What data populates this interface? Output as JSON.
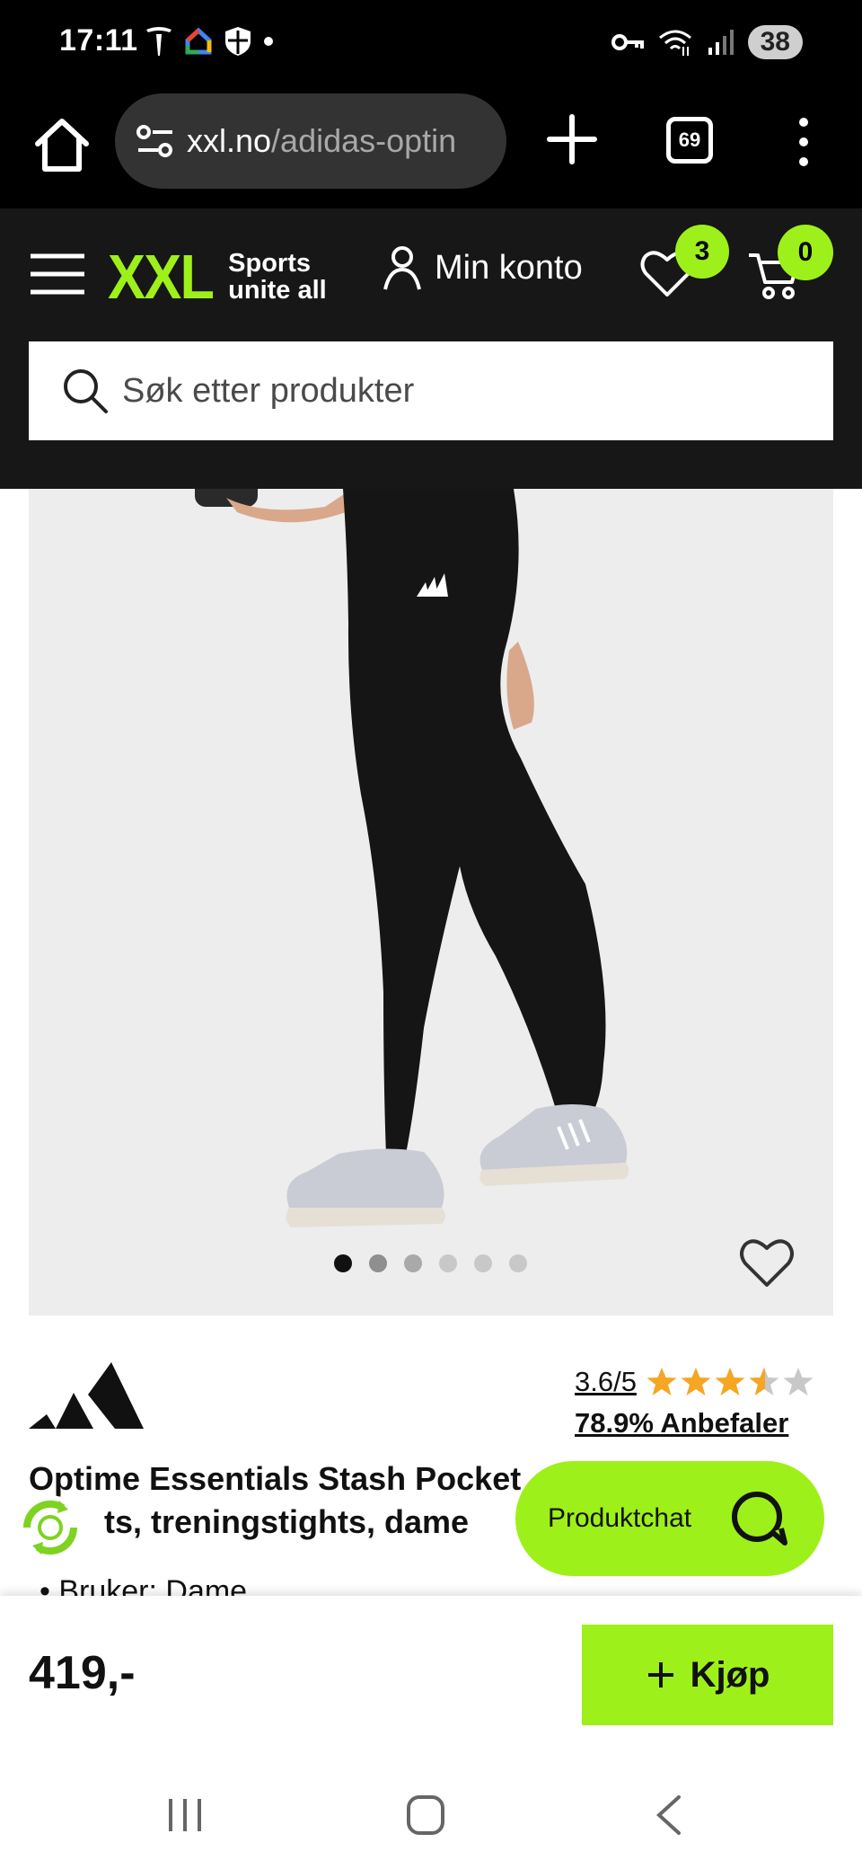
{
  "status_bar": {
    "time": "17:11",
    "battery": "38"
  },
  "browser": {
    "url_domain": "xxl.no",
    "url_path": "/adidas-optin",
    "tab_count": "69"
  },
  "header": {
    "logo_text": "XXL",
    "tagline_1": "Sports",
    "tagline_2": "unite all",
    "account_label": "Min konto",
    "wishlist_count": "3",
    "cart_count": "0",
    "search_placeholder": "Søk etter produkter"
  },
  "gallery": {
    "image_count": 6,
    "active_index": 0
  },
  "product": {
    "brand": "adidas",
    "rating": "3.6/5",
    "rating_value": 3.6,
    "rating_max": 5,
    "recommend": "78.9% Anbefaler",
    "title_line1": "Optime Essentials Stash Pocket",
    "title_line2": "ts, treningstights, dame",
    "bullet_1": "Bruker: Dame",
    "price": "419,-",
    "buy_label": "Kjøp"
  },
  "chat": {
    "label": "Produktchat"
  },
  "colors": {
    "accent": "#9ef01a",
    "header_bg": "#171717",
    "star": "#f5a623"
  }
}
